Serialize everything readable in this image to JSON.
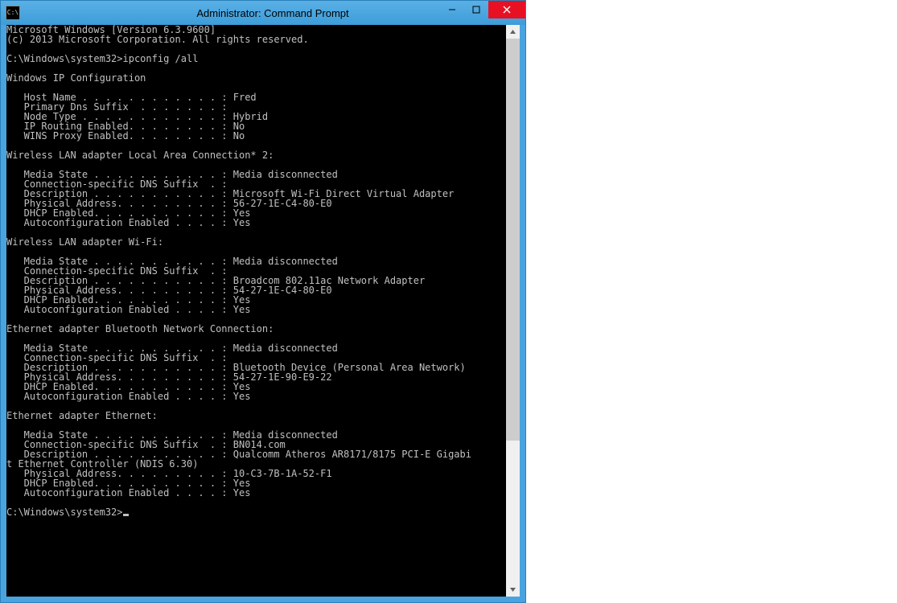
{
  "window": {
    "title": "Administrator: Command Prompt",
    "icon_label": "C:\\"
  },
  "console_lines": [
    "Microsoft Windows [Version 6.3.9600]",
    "(c) 2013 Microsoft Corporation. All rights reserved.",
    "",
    "C:\\Windows\\system32>ipconfig /all",
    "",
    "Windows IP Configuration",
    "",
    "   Host Name . . . . . . . . . . . . : Fred",
    "   Primary Dns Suffix  . . . . . . . :",
    "   Node Type . . . . . . . . . . . . : Hybrid",
    "   IP Routing Enabled. . . . . . . . : No",
    "   WINS Proxy Enabled. . . . . . . . : No",
    "",
    "Wireless LAN adapter Local Area Connection* 2:",
    "",
    "   Media State . . . . . . . . . . . : Media disconnected",
    "   Connection-specific DNS Suffix  . :",
    "   Description . . . . . . . . . . . : Microsoft Wi-Fi Direct Virtual Adapter",
    "   Physical Address. . . . . . . . . : 56-27-1E-C4-80-E0",
    "   DHCP Enabled. . . . . . . . . . . : Yes",
    "   Autoconfiguration Enabled . . . . : Yes",
    "",
    "Wireless LAN adapter Wi-Fi:",
    "",
    "   Media State . . . . . . . . . . . : Media disconnected",
    "   Connection-specific DNS Suffix  . :",
    "   Description . . . . . . . . . . . : Broadcom 802.11ac Network Adapter",
    "   Physical Address. . . . . . . . . : 54-27-1E-C4-80-E0",
    "   DHCP Enabled. . . . . . . . . . . : Yes",
    "   Autoconfiguration Enabled . . . . : Yes",
    "",
    "Ethernet adapter Bluetooth Network Connection:",
    "",
    "   Media State . . . . . . . . . . . : Media disconnected",
    "   Connection-specific DNS Suffix  . :",
    "   Description . . . . . . . . . . . : Bluetooth Device (Personal Area Network)",
    "   Physical Address. . . . . . . . . : 54-27-1E-90-E9-22",
    "   DHCP Enabled. . . . . . . . . . . : Yes",
    "   Autoconfiguration Enabled . . . . : Yes",
    "",
    "Ethernet adapter Ethernet:",
    "",
    "   Media State . . . . . . . . . . . : Media disconnected",
    "   Connection-specific DNS Suffix  . : BN014.com",
    "   Description . . . . . . . . . . . : Qualcomm Atheros AR8171/8175 PCI-E Gigabi",
    "t Ethernet Controller (NDIS 6.30)",
    "   Physical Address. . . . . . . . . : 10-C3-7B-1A-52-F1",
    "   DHCP Enabled. . . . . . . . . . . : Yes",
    "   Autoconfiguration Enabled . . . . : Yes",
    "",
    "C:\\Windows\\system32>"
  ]
}
